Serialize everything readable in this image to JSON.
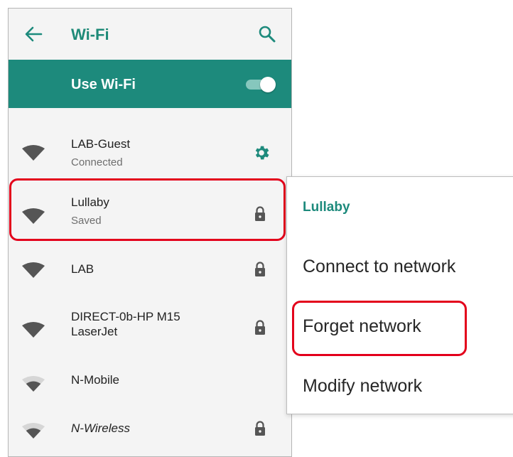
{
  "header": {
    "title": "Wi-Fi"
  },
  "wifi_toggle": {
    "label": "Use Wi-Fi",
    "state": "on"
  },
  "networks": [
    {
      "name": "LAB-Guest",
      "status": "Connected",
      "action_icon": "gear-icon"
    },
    {
      "name": "Lullaby",
      "status": "Saved",
      "action_icon": "lock-icon"
    },
    {
      "name": "LAB",
      "status": "",
      "action_icon": "lock-icon"
    },
    {
      "name": "DIRECT-0b-HP M15 LaserJet",
      "status": "",
      "action_icon": "lock-icon"
    },
    {
      "name": "N-Mobile",
      "status": "",
      "action_icon": ""
    },
    {
      "name": "N-Wireless",
      "status": "",
      "action_icon": "lock-icon"
    }
  ],
  "context_menu": {
    "title": "Lullaby",
    "items": [
      "Connect to network",
      "Forget network",
      "Modify network"
    ]
  },
  "colors": {
    "accent": "#1d8a7c",
    "highlight": "#e3001b",
    "background": "#f4f4f4"
  }
}
